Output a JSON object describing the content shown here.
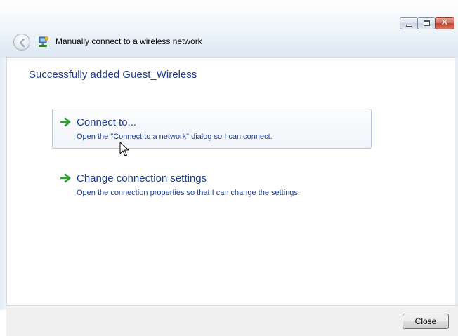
{
  "window": {
    "title": "Manually connect to a wireless network",
    "controls": {
      "minimize_icon": "minimize-icon",
      "maximize_icon": "maximize-icon",
      "close_icon": "close-icon",
      "close_glyph": "✕"
    },
    "back_icon": "back-arrow-icon",
    "title_icon": "wireless-network-icon"
  },
  "main": {
    "heading": "Successfully added Guest_Wireless",
    "options": [
      {
        "title": "Connect to...",
        "description": "Open the \"Connect to a network\" dialog so I can connect.",
        "icon": "green-arrow-icon",
        "highlighted": true
      },
      {
        "title": "Change connection settings",
        "description": "Open the connection properties so that I can change the settings.",
        "icon": "green-arrow-icon",
        "highlighted": false
      }
    ]
  },
  "footer": {
    "close_label": "Close"
  },
  "colors": {
    "link": "#1e3b8f",
    "arrow": "#2e9c2e",
    "close_button_red": "#c0442f"
  }
}
